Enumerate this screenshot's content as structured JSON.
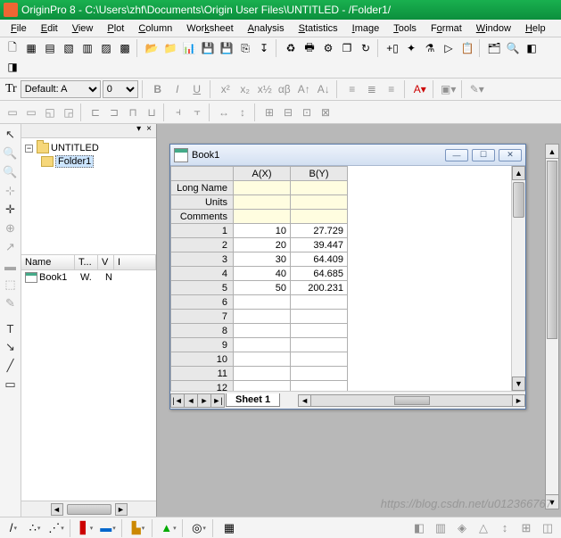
{
  "title": "OriginPro 8 - C:\\Users\\zhf\\Documents\\Origin User Files\\UNTITLED - /Folder1/",
  "menu": [
    "File",
    "Edit",
    "View",
    "Plot",
    "Column",
    "Worksheet",
    "Analysis",
    "Statistics",
    "Image",
    "Tools",
    "Format",
    "Window",
    "Help"
  ],
  "font": {
    "label": "Tr",
    "name": "Default: A",
    "size": "0"
  },
  "explorer": {
    "tree": {
      "root": "UNTITLED",
      "child": "Folder1"
    },
    "headers": [
      "Name",
      "T...",
      "V",
      "I"
    ],
    "rows": [
      {
        "name": "Book1",
        "type": "W.",
        "view": "N"
      }
    ]
  },
  "book": {
    "title": "Book1",
    "columns": [
      "A(X)",
      "B(Y)"
    ],
    "meta_rows": [
      "Long Name",
      "Units",
      "Comments"
    ],
    "data_rows": [
      {
        "n": "1",
        "a": "10",
        "b": "27.729"
      },
      {
        "n": "2",
        "a": "20",
        "b": "39.447"
      },
      {
        "n": "3",
        "a": "30",
        "b": "64.409"
      },
      {
        "n": "4",
        "a": "40",
        "b": "64.685"
      },
      {
        "n": "5",
        "a": "50",
        "b": "200.231"
      },
      {
        "n": "6",
        "a": "",
        "b": ""
      },
      {
        "n": "7",
        "a": "",
        "b": ""
      },
      {
        "n": "8",
        "a": "",
        "b": ""
      },
      {
        "n": "9",
        "a": "",
        "b": ""
      },
      {
        "n": "10",
        "a": "",
        "b": ""
      },
      {
        "n": "11",
        "a": "",
        "b": ""
      },
      {
        "n": "12",
        "a": "",
        "b": ""
      }
    ],
    "sheet_tab": "Sheet 1"
  },
  "chart_data": {
    "type": "table",
    "columns": [
      "A(X)",
      "B(Y)"
    ],
    "x": [
      10,
      20,
      30,
      40,
      50
    ],
    "y": [
      27.729,
      39.447,
      64.409,
      64.685,
      200.231
    ]
  },
  "watermark": "https://blog.csdn.net/u012366767"
}
